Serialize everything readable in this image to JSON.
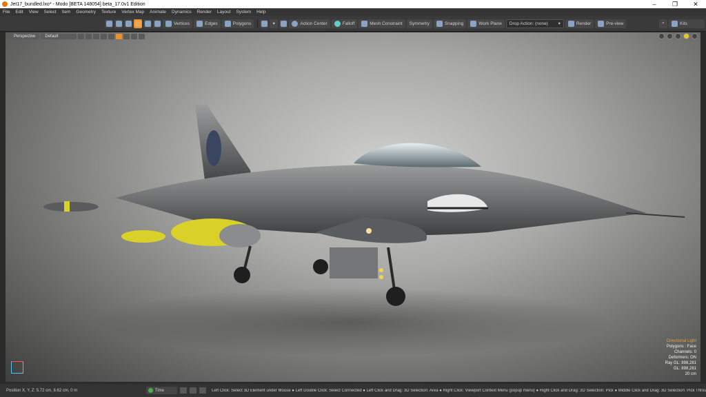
{
  "window": {
    "title": "Jet17_bundled.lxo* - Modo [BETA 148054]  beta_17.0v1 Edition",
    "controls": [
      "–",
      "❐",
      "✕"
    ]
  },
  "menu": [
    "File",
    "Edit",
    "View",
    "Select",
    "Item",
    "Geometry",
    "Texture",
    "Vertex Map",
    "Animate",
    "Dynamics",
    "Render",
    "Layout",
    "System",
    "Help"
  ],
  "toolbar": {
    "vertices": "Vertices",
    "edges": "Edges",
    "polygons": "Polygons",
    "action_center": "Action Center",
    "falloff": "Falloff",
    "mesh_constraint": "Mesh Constraint",
    "symmetry": "Symmetry",
    "snapping": "Snapping",
    "work_plane": "Work Plane",
    "drop_action": "Drop Action: (none)",
    "render": "Render",
    "preview": "Pre-view",
    "kits": "Kits"
  },
  "viewport": {
    "view_mode": "Perspective",
    "shading": "Default"
  },
  "info": {
    "light": "Directional Light",
    "polygons": "Polygons : Face",
    "channels": "Channels: 0",
    "deformers": "Deformers: ON",
    "ray_gl": "Ray GL: 898,281",
    "gl": "GL: 898,281",
    "scale": "20 cm"
  },
  "status": {
    "position": "Position X, Y, Z:   5.72 cm, 8.62 cm, 0 m",
    "time": "Time",
    "hints": "Left Click: Select 3D Element under Mouse ● Left Double Click: Select Connected ● Left Click and Drag: 3D Selection: Area ● Right Click: Viewport Context Menu (popup menu) ● Right Click and Drag: 3D Selection: Pick ● Middle Click and Drag: 3D Selection: Pick Through"
  }
}
